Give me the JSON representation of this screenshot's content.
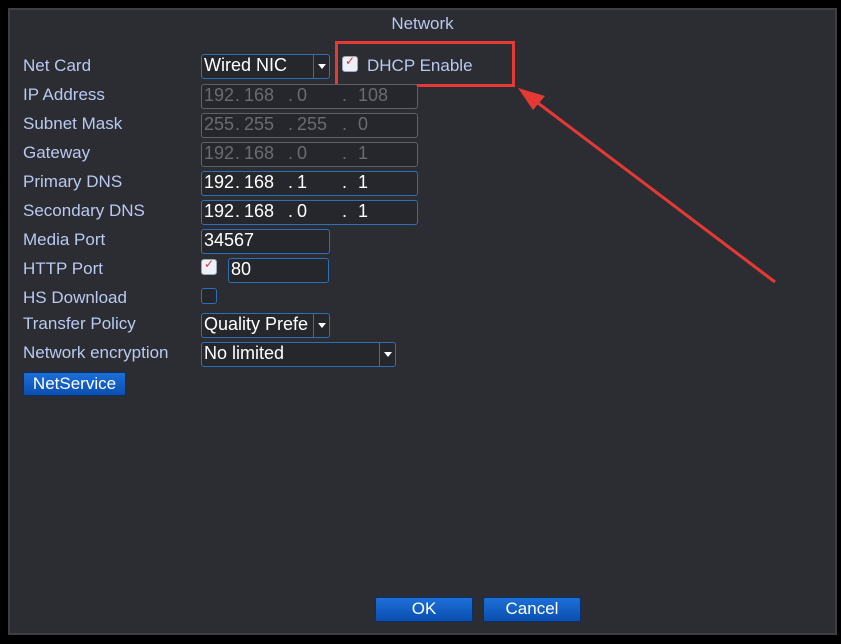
{
  "title": "Network",
  "labels": [
    "Net Card",
    "IP Address",
    "Subnet Mask",
    "Gateway",
    "Primary DNS",
    "Secondary DNS",
    "Media Port",
    "HTTP Port",
    "HS Download",
    "Transfer Policy",
    "Network encryption"
  ],
  "net_card": "Wired NIC",
  "dhcp": {
    "label": "DHCP Enable",
    "checked": true
  },
  "ip_address": [
    "192",
    "168",
    "0",
    "108"
  ],
  "subnet_mask": [
    "255",
    "255",
    "255",
    "0"
  ],
  "gateway": [
    "192",
    "168",
    "0",
    "1"
  ],
  "primary_dns": [
    "192",
    "168",
    "1",
    "1"
  ],
  "secondary_dns": [
    "192",
    "168",
    "0",
    "1"
  ],
  "media_port": "34567",
  "http_port": {
    "checked": true,
    "value": "80"
  },
  "hs_download": {
    "checked": false
  },
  "transfer_policy": "Quality Prefe",
  "network_encryption": "No limited",
  "netservice": "NetService",
  "ok": "OK",
  "cancel": "Cancel",
  "colors": {
    "highlight": "#e53935",
    "accent": "#1d6fd8"
  }
}
